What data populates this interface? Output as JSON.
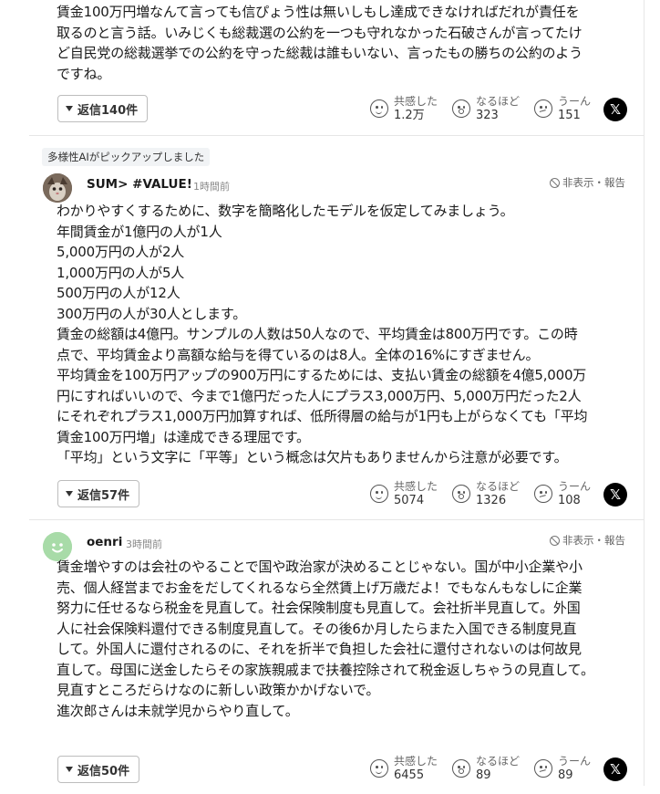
{
  "comments": [
    {
      "text": "賃金100万円増なんて言っても信ぴょう性は無いしもし達成できなければだれが責任を\n取るのと言う話。いみじくも総裁選の公約を一つも守れなかった石破さんが言ってたけ\nど自民党の総裁選挙での公約を守った総裁は誰もいない、言ったもの勝ちの公約のよう\nですね。",
      "reply_label": "返信140件",
      "reactions": [
        {
          "label": "共感した",
          "count": "1.2万",
          "icon": "smile-face-icon"
        },
        {
          "label": "なるほど",
          "count": "323",
          "icon": "surprised-face-icon"
        },
        {
          "label": "うーん",
          "count": "151",
          "icon": "thinking-face-icon"
        }
      ]
    },
    {
      "ai_badge": "多様性AIがピックアップしました",
      "username": "SUM> #VALUE!",
      "time": "1時間前",
      "hide_report": "非表示・報告",
      "text": "わかりやすくするために、数字を簡略化したモデルを仮定してみましょう。\n年間賃金が1億円の人が1人\n5,000万円の人が2人\n1,000万円の人が5人\n500万円の人が12人\n300万円の人が30人とします。\n賃金の総額は4億円。サンプルの人数は50人なので、平均賃金は800万円です。この時\n点で、平均賃金より高額な給与を得ているのは8人。全体の16%にすぎません。\n平均賃金を100万円アップの900万円にするためには、支払い賃金の総額を4億5,000万\n円にすればいいので、今まで1億円だった人にプラス3,000万円、5,000万円だった2人\nにそれぞれプラス1,000万円加算すれば、低所得層の給与が1円も上がらなくても「平均\n賃金100万円増」は達成できる理屈です。\n「平均」という文字に「平等」という概念は欠片もありませんから注意が必要です。",
      "reply_label": "返信57件",
      "reactions": [
        {
          "label": "共感した",
          "count": "5074",
          "icon": "smile-face-icon"
        },
        {
          "label": "なるほど",
          "count": "1326",
          "icon": "surprised-face-icon"
        },
        {
          "label": "うーん",
          "count": "108",
          "icon": "thinking-face-icon"
        }
      ]
    },
    {
      "username": "oenri",
      "time": "3時間前",
      "hide_report": "非表示・報告",
      "text": "賃金増やすのは会社のやることで国や政治家が決めることじゃない。国が中小企業や小\n売、個人経営までお金をだしてくれるなら全然賃上げ万歳だよ！でもなんもなしに企業\n努力に任せるなら税金を見直して。社会保険制度も見直して。会社折半見直して。外国\n人に社会保険料還付できる制度見直して。その後6か月したらまた入国できる制度見直\nして。外国人に還付されるのに、それを折半で負担した会社に還付されないのは何故見\n直して。母国に送金したらその家族親戚まで扶養控除されて税金返しちゃうの見直して。\n見直すところだらけなのに新しい政策かかげないで。\n進次郎さんは未就学児からやり直して。",
      "reply_label": "返信50件",
      "reactions": [
        {
          "label": "共感した",
          "count": "6455",
          "icon": "smile-face-icon"
        },
        {
          "label": "なるほど",
          "count": "89",
          "icon": "surprised-face-icon"
        },
        {
          "label": "うーん",
          "count": "89",
          "icon": "thinking-face-icon"
        }
      ]
    }
  ],
  "share_icon": "x-logo-icon",
  "colors": {
    "text": "#1a1a1a",
    "muted": "#888888",
    "divider": "#e6e6e6",
    "avatar_green": "#a8dba8"
  }
}
